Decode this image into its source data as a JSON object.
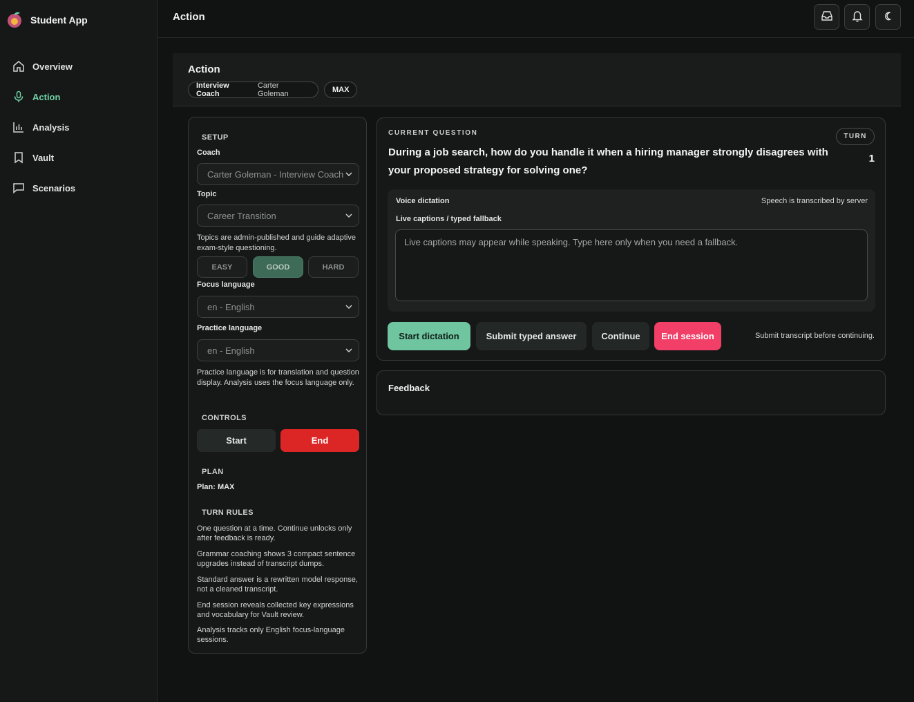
{
  "app": {
    "title": "Student App"
  },
  "sidebar": {
    "items": [
      {
        "label": "Overview",
        "icon": "home-icon"
      },
      {
        "label": "Action",
        "icon": "microphone-icon",
        "active": true
      },
      {
        "label": "Analysis",
        "icon": "bar-chart-icon"
      },
      {
        "label": "Vault",
        "icon": "bookmark-icon"
      },
      {
        "label": "Scenarios",
        "icon": "chat-bubble-icon"
      }
    ]
  },
  "topbar": {
    "title": "Action",
    "buttons": [
      "inbox-icon",
      "bell-icon",
      "moon-icon"
    ]
  },
  "header": {
    "title": "Action",
    "coach_chip_label": "Interview Coach",
    "coach_chip_name": "Carter Goleman",
    "plan_chip": "MAX"
  },
  "setup": {
    "section_setup": "SETUP",
    "coach_label": "Coach",
    "coach_value": "Carter Goleman - Interview Coach",
    "topic_label": "Topic",
    "topic_value": "Career Transition",
    "topic_help": "Topics are admin-published and guide adaptive exam-style questioning.",
    "difficulty": [
      "EASY",
      "GOOD",
      "HARD"
    ],
    "difficulty_selected": "GOOD",
    "focus_label": "Focus language",
    "focus_value": "en - English",
    "practice_label": "Practice language",
    "practice_value": "en - English",
    "practice_help": "Practice language is for translation and question display. Analysis uses the focus language only.",
    "section_controls": "CONTROLS",
    "start_label": "Start",
    "end_label": "End",
    "section_plan": "PLAN",
    "plan_text": "Plan: MAX",
    "section_rules": "TURN RULES",
    "rules": [
      "One question at a time. Continue unlocks only after feedback is ready.",
      "Grammar coaching shows 3 compact sentence upgrades instead of transcript dumps.",
      "Standard answer is a rewritten model response, not a cleaned transcript.",
      "End session reveals collected key expressions and vocabulary for Vault review.",
      "Analysis tracks only English focus-language sessions."
    ]
  },
  "question": {
    "label": "CURRENT QUESTION",
    "text": "During a job search, how do you handle it when a hiring manager strongly disagrees with your proposed strategy for solving one?",
    "turn_label": "TURN",
    "turn_value": "1",
    "dictation_title": "Voice dictation",
    "dictation_note": "Speech is transcribed by server",
    "captions_label": "Live captions / typed fallback",
    "captions_placeholder": "Live captions may appear while speaking. Type here only when you need a fallback.",
    "btn_start_dictation": "Start dictation",
    "btn_submit_typed": "Submit typed answer",
    "btn_continue": "Continue",
    "btn_end_session": "End session",
    "hint": "Submit transcript before continuing."
  },
  "feedback": {
    "title": "Feedback"
  },
  "colors": {
    "accent": "#6fd0a6",
    "danger": "#dc2626",
    "pink": "#f23f68",
    "good": "#3e6a58"
  }
}
